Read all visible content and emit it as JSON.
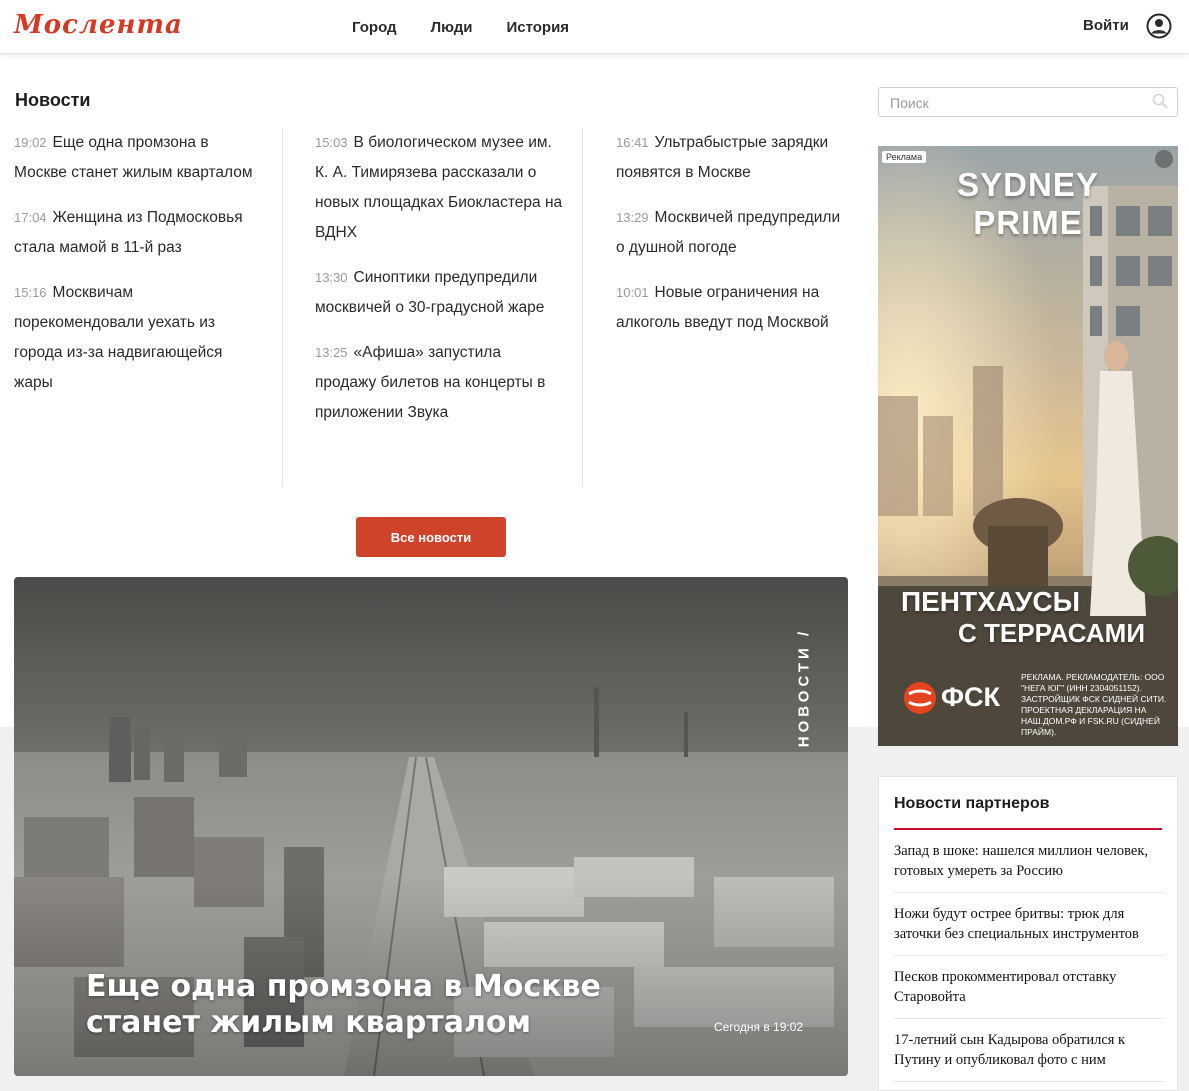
{
  "header": {
    "logo": "Мослента",
    "nav": [
      "Город",
      "Люди",
      "История"
    ],
    "login_label": "Войти"
  },
  "news": {
    "section_title": "Новости",
    "columns": [
      [
        {
          "time": "19:02",
          "title": "Еще одна промзона в Москве станет жилым кварталом"
        },
        {
          "time": "17:04",
          "title": "Женщина из Подмосковья стала мамой в 11-й раз"
        },
        {
          "time": "15:16",
          "title": "Москвичам порекомендовали уехать из города из-за надвигающейся жары"
        }
      ],
      [
        {
          "time": "15:03",
          "title": "В биологическом музее им. К. А. Тимирязева рассказали о новых площадках Биокластера на ВДНХ"
        },
        {
          "time": "13:30",
          "title": "Синоптики предупредили москвичей о 30-градусной жаре"
        },
        {
          "time": "13:25",
          "title": "«Афиша» запустила продажу билетов на концерты в приложении Звука"
        }
      ],
      [
        {
          "time": "16:41",
          "title": "Ультрабыстрые зарядки появятся в Москве"
        },
        {
          "time": "13:29",
          "title": "Москвичей предупредили о душной погоде"
        },
        {
          "time": "10:01",
          "title": "Новые ограничения на алкоголь введут под Москвой"
        }
      ]
    ],
    "all_news_label": "Все новости"
  },
  "hero": {
    "rubric": "НОВОСТИ /",
    "title": "Еще одна промзона в Москве станет жилым кварталом",
    "date": "Сегодня в 19:02"
  },
  "search": {
    "placeholder": "Поиск",
    "value": ""
  },
  "ad": {
    "label": "Реклама",
    "brand": "SYDNEY PRIME",
    "headline_line1": "ПЕНТХАУСЫ",
    "headline_line2": "С ТЕРРАСАМИ",
    "company": "ФСК",
    "legal": "РЕКЛАМА. РЕКЛАМОДАТЕЛЬ: ООО \"НЕГА ЮГ\" (ИНН 2304051152). ЗАСТРОЙЩИК ФСК СИДНЕЙ СИТИ. ПРОЕКТНАЯ ДЕКЛАРАЦИЯ НА НАШ.ДОМ.РФ И FSK.RU (СИДНЕЙ ПРАЙМ)."
  },
  "partners": {
    "title": "Новости партнеров",
    "items": [
      "Запад в шоке: нашелся миллион человек, готовых умереть за Россию",
      "Ножи будут острее бритвы: трюк для заточки без специальных инструментов",
      "Песков прокомментировал отставку Старовойта",
      "17-летний сын Кадырова обратился к Путину и опубликовал фото с ним"
    ]
  },
  "colors": {
    "accent": "#d0432b",
    "logo": "#d23a24",
    "partner_rule": "#c8102e"
  }
}
